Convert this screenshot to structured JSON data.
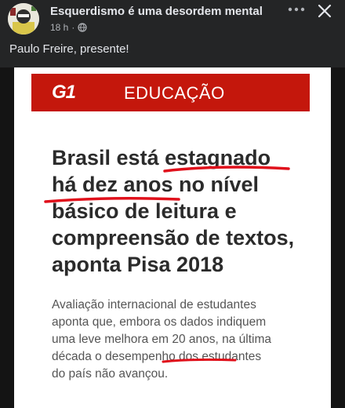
{
  "post": {
    "page_name": "Esquerdismo é uma desordem mental",
    "time": "18 h",
    "caption": "Paulo Freire, presente!",
    "more_icon": "more-horizontal-icon",
    "close_icon": "close-icon",
    "privacy_icon": "globe-icon"
  },
  "article": {
    "logo": "G1",
    "section": "EDUCAÇÃO",
    "brand_color": "#c4170c",
    "headline_lines": [
      "Brasil está estagnado",
      "há dez anos no nível",
      "básico de leitura e",
      "compreensão de textos,",
      "aponta Pisa 2018"
    ],
    "summary_lines": [
      "Avaliação internacional de estudantes",
      "aponta que, embora os dados indiquem",
      "uma leve melhora em 20 anos, na última",
      "década o desempenho dos estudantes",
      "do país não avançou."
    ],
    "annotation_color": "#e0101b"
  }
}
